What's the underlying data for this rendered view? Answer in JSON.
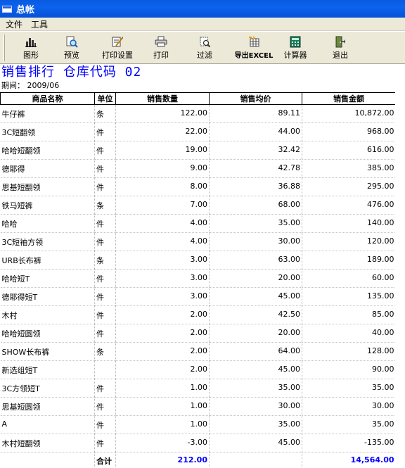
{
  "window": {
    "title": "总帐"
  },
  "menu": [
    {
      "label": "文件"
    },
    {
      "label": "工具"
    }
  ],
  "toolbar": {
    "buttons": [
      {
        "label": "图形",
        "icon": "chart-icon"
      },
      {
        "label": "预览",
        "icon": "preview-icon"
      },
      {
        "label": "打印设置",
        "icon": "print-settings-icon"
      },
      {
        "label": "打印",
        "icon": "printer-icon"
      },
      {
        "label": "过滤",
        "icon": "filter-icon"
      },
      {
        "label": "导出EXCEL",
        "icon": "export-excel-icon"
      },
      {
        "label": "计算器",
        "icon": "calculator-icon"
      },
      {
        "label": "退出",
        "icon": "exit-icon"
      }
    ]
  },
  "report": {
    "title": "销售排行 仓库代码 02",
    "period_label": "期间：",
    "period_value": "2009/06",
    "title_color": "#0000ff"
  },
  "table": {
    "headers": [
      "商品名称",
      "单位",
      "销售数量",
      "销售均价",
      "销售金额"
    ],
    "rows": [
      [
        "牛仔裤",
        "条",
        "122.00",
        "89.11",
        "10,872.00"
      ],
      [
        "3C短翻领",
        "件",
        "22.00",
        "44.00",
        "968.00"
      ],
      [
        "哈哈短翻领",
        "件",
        "19.00",
        "32.42",
        "616.00"
      ],
      [
        "德耶得",
        "件",
        "9.00",
        "42.78",
        "385.00"
      ],
      [
        "思基短翻领",
        "件",
        "8.00",
        "36.88",
        "295.00"
      ],
      [
        "铁马短裤",
        "条",
        "7.00",
        "68.00",
        "476.00"
      ],
      [
        "哈哈",
        "件",
        "4.00",
        "35.00",
        "140.00"
      ],
      [
        "3C短袖方领",
        "件",
        "4.00",
        "30.00",
        "120.00"
      ],
      [
        "URB长布裤",
        "条",
        "3.00",
        "63.00",
        "189.00"
      ],
      [
        "哈哈短T",
        "件",
        "3.00",
        "20.00",
        "60.00"
      ],
      [
        "德耶得短T",
        "件",
        "3.00",
        "45.00",
        "135.00"
      ],
      [
        "木村",
        "件",
        "2.00",
        "42.50",
        "85.00"
      ],
      [
        "哈哈短圆领",
        "件",
        "2.00",
        "20.00",
        "40.00"
      ],
      [
        "SHOW长布裤",
        "条",
        "2.00",
        "64.00",
        "128.00"
      ],
      [
        "新选组短T",
        "",
        "2.00",
        "45.00",
        "90.00"
      ],
      [
        "3C方领短T",
        "件",
        "1.00",
        "35.00",
        "35.00"
      ],
      [
        "思基短圆领",
        "件",
        "1.00",
        "30.00",
        "30.00"
      ],
      [
        "A",
        "件",
        "1.00",
        "35.00",
        "35.00"
      ],
      [
        "木村短翻领",
        "件",
        "-3.00",
        "45.00",
        "-135.00"
      ]
    ],
    "total": {
      "label": "合计",
      "quantity": "212.00",
      "amount": "14,564.00"
    }
  }
}
